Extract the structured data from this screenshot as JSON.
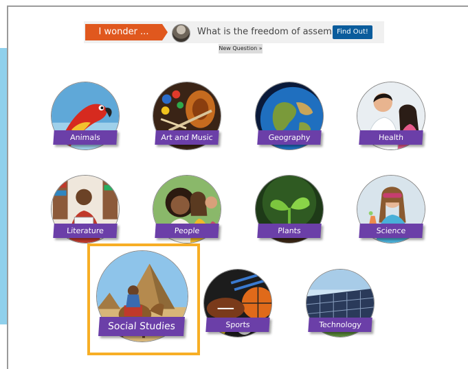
{
  "wonder": {
    "tag": "I wonder ...",
    "question": "What is the freedom of assembly?",
    "find_out": "Find Out!",
    "new_question": "New Question »"
  },
  "topics": [
    {
      "label": "Animals",
      "icon": "parrot-image"
    },
    {
      "label": "Art and Music",
      "icon": "violin-paint-image"
    },
    {
      "label": "Geography",
      "icon": "globe-image"
    },
    {
      "label": "Health",
      "icon": "doctor-child-image"
    },
    {
      "label": "Literature",
      "icon": "reader-image"
    },
    {
      "label": "People",
      "icon": "group-people-image"
    },
    {
      "label": "Plants",
      "icon": "sprout-image"
    },
    {
      "label": "Science",
      "icon": "scientist-image"
    },
    {
      "label": "Social Studies",
      "icon": "pyramid-camel-image"
    },
    {
      "label": "Sports",
      "icon": "sports-balls-image"
    },
    {
      "label": "Technology",
      "icon": "solar-panels-image"
    }
  ],
  "colors": {
    "accent_purple": "#6b3fa8",
    "wonder_orange": "#e0581e",
    "find_out_blue": "#0a5c9c",
    "highlight_yellow": "#f7ae25",
    "side_panel": "#8fd0ec"
  }
}
